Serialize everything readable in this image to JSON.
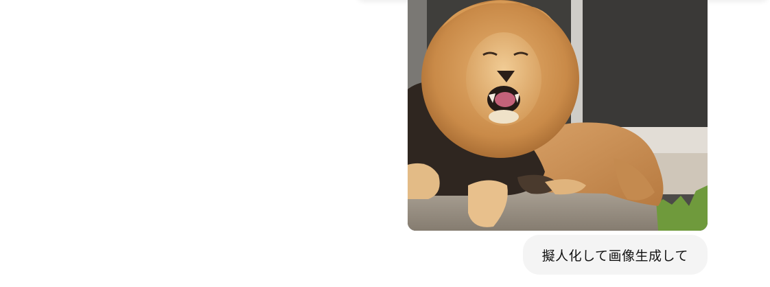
{
  "message": {
    "text": "擬人化して画像生成して"
  },
  "attachment": {
    "subject": "lion",
    "icon": "lion-photo"
  },
  "colors": {
    "bubble_bg": "#f4f4f4",
    "page_bg": "#ffffff",
    "text": "#111111"
  }
}
